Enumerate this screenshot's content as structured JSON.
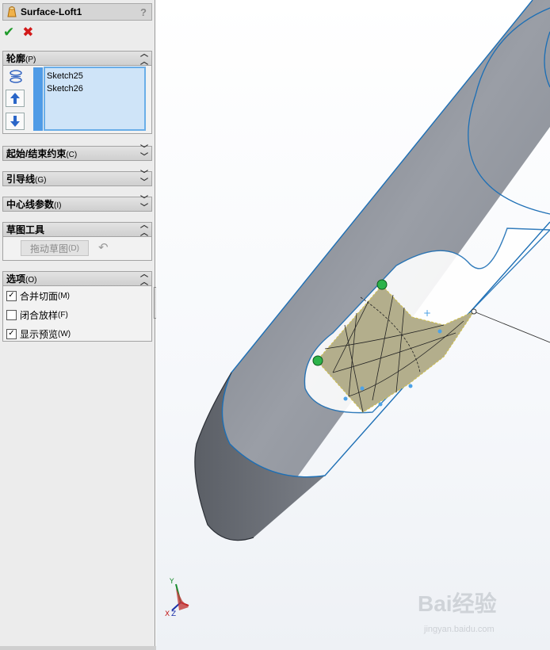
{
  "feature": {
    "title": "Surface-Loft1",
    "help": "?"
  },
  "confirm": {
    "ok": "✔",
    "cancel": "✖"
  },
  "profile": {
    "label": "轮廓",
    "shortcut": "(P)",
    "items": [
      "Sketch25",
      "Sketch26"
    ]
  },
  "sections": {
    "start_end": {
      "label": "起始/结束约束",
      "shortcut": "(C)"
    },
    "guides": {
      "label": "引导线",
      "shortcut": "(G)"
    },
    "centerline": {
      "label": "中心线参数",
      "shortcut": "(I)"
    },
    "sketch_tools": {
      "label": "草图工具",
      "drag_label": "拖动草图",
      "drag_shortcut": "(D)"
    },
    "options": {
      "label": "选项",
      "shortcut": "(O)",
      "items": [
        {
          "label": "合并切面",
          "shortcut": "(M)",
          "checked": true
        },
        {
          "label": "闭合放样",
          "shortcut": "(F)",
          "checked": false
        },
        {
          "label": "显示预览",
          "shortcut": "(W)",
          "checked": true
        }
      ]
    }
  },
  "triad": {
    "x": "X",
    "y": "Y",
    "z": "Z"
  },
  "watermark": {
    "brand": "Bai经验",
    "url": "jingyan.baidu.com"
  },
  "colors": {
    "panel_bg": "#ececec",
    "list_bg": "#cfe4f8",
    "list_border": "#6aaee8",
    "body_gray": "#8a8f98",
    "edge_blue": "#1d6fb5",
    "loft_fill": "#b3ae8c",
    "point_green": "#2db34a"
  }
}
